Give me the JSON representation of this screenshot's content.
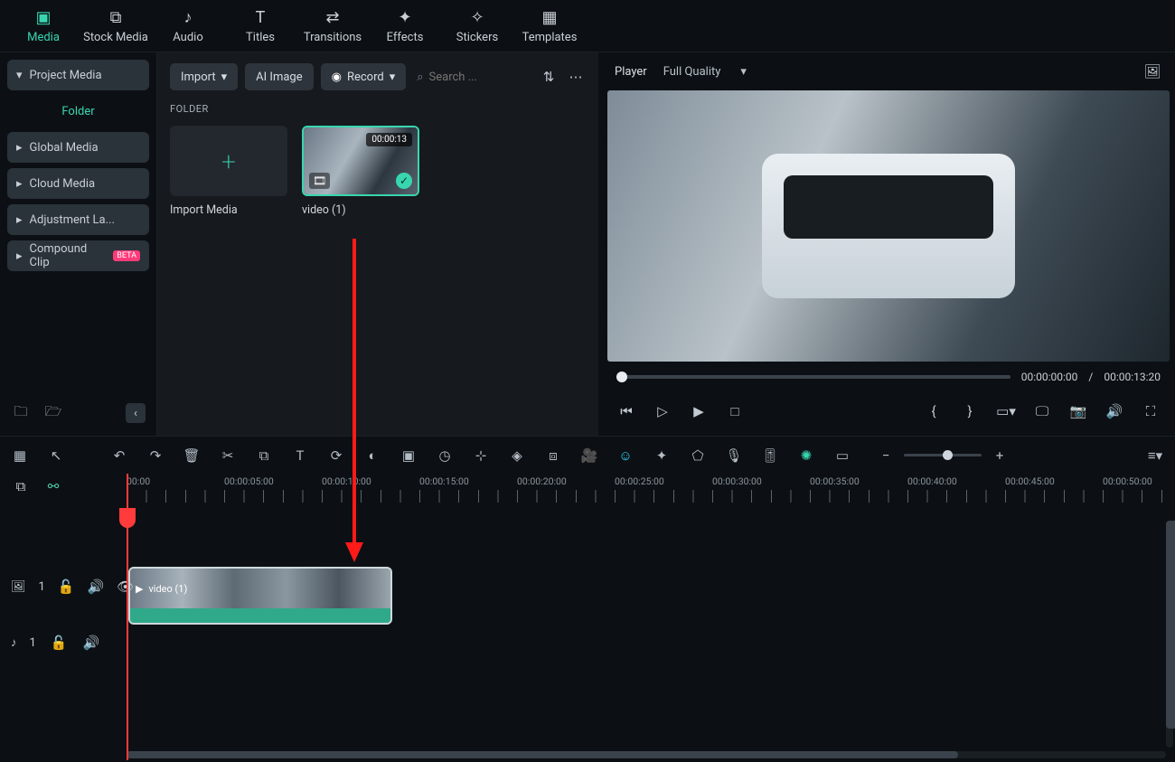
{
  "topTabs": [
    {
      "label": "Media",
      "icon": "▣"
    },
    {
      "label": "Stock Media",
      "icon": "⧉"
    },
    {
      "label": "Audio",
      "icon": "♪"
    },
    {
      "label": "Titles",
      "icon": "T"
    },
    {
      "label": "Transitions",
      "icon": "⇄"
    },
    {
      "label": "Effects",
      "icon": "✦"
    },
    {
      "label": "Stickers",
      "icon": "✧"
    },
    {
      "label": "Templates",
      "icon": "▦"
    }
  ],
  "sidebar": {
    "projectMedia": "Project Media",
    "folder": "Folder",
    "globalMedia": "Global Media",
    "cloudMedia": "Cloud Media",
    "adjustment": "Adjustment La...",
    "compound": "Compound Clip",
    "compoundBadge": "BETA"
  },
  "midToolbar": {
    "import": "Import",
    "aiImage": "AI Image",
    "record": "Record",
    "searchPlaceholder": "Search ..."
  },
  "folderLabel": "FOLDER",
  "thumbs": {
    "importMedia": "Import Media",
    "video1": "video (1)",
    "video1Duration": "00:00:13"
  },
  "player": {
    "title": "Player",
    "quality": "Full Quality",
    "currentTime": "00:00:00:00",
    "sep": "/",
    "totalTime": "00:00:13:20"
  },
  "ruler": [
    "00:00",
    "00:00:05:00",
    "00:00:10:00",
    "00:00:15:00",
    "00:00:20:00",
    "00:00:25:00",
    "00:00:30:00",
    "00:00:35:00",
    "00:00:40:00",
    "00:00:45:00",
    "00:00:50:00"
  ],
  "tracks": {
    "videoTrackNum": "1",
    "audioTrackNum": "1",
    "clipLabel": "video (1)"
  }
}
